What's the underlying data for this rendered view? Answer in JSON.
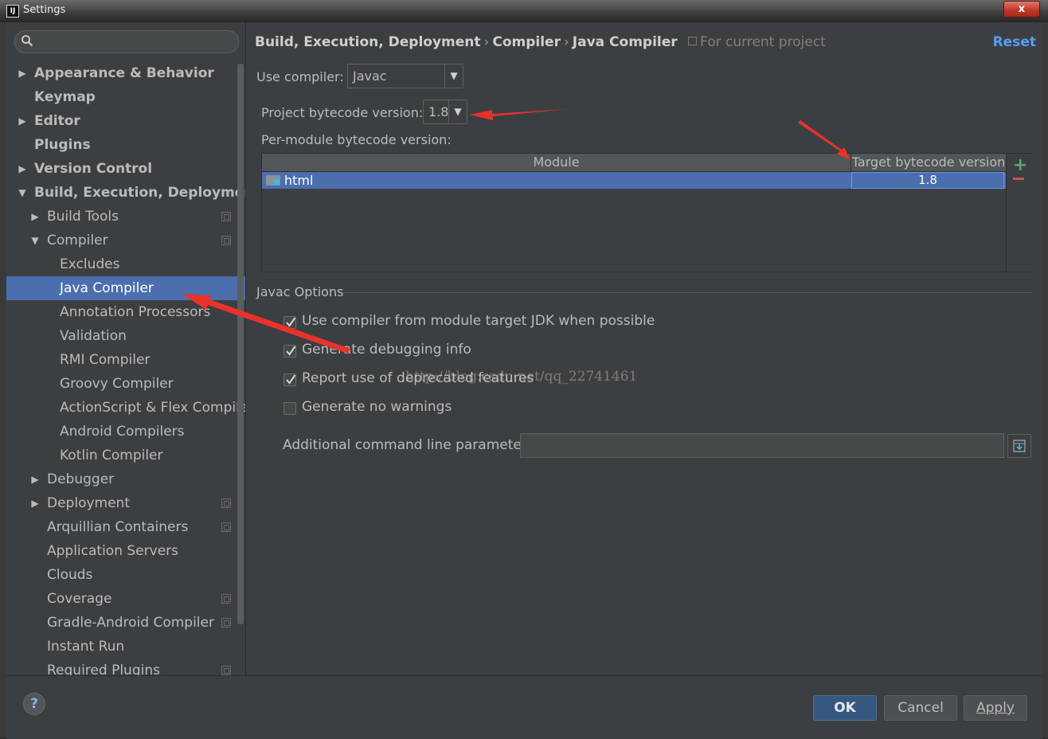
{
  "window": {
    "title": "Settings",
    "close": "x"
  },
  "sidebar": {
    "search_placeholder": "",
    "items": [
      {
        "label": "Appearance & Behavior",
        "bold": true,
        "level": 0,
        "arrow": "▶"
      },
      {
        "label": "Keymap",
        "bold": true,
        "level": 0,
        "arrow": ""
      },
      {
        "label": "Editor",
        "bold": true,
        "level": 0,
        "arrow": "▶"
      },
      {
        "label": "Plugins",
        "bold": true,
        "level": 0,
        "arrow": ""
      },
      {
        "label": "Version Control",
        "bold": true,
        "level": 0,
        "arrow": "▶"
      },
      {
        "label": "Build, Execution, Deployment",
        "bold": true,
        "level": 0,
        "arrow": "▼"
      },
      {
        "label": "Build Tools",
        "level": 1,
        "arrow": "▶",
        "project": true
      },
      {
        "label": "Compiler",
        "level": 1,
        "arrow": "▼",
        "project": true
      },
      {
        "label": "Excludes",
        "level": 2,
        "arrow": ""
      },
      {
        "label": "Java Compiler",
        "level": 2,
        "arrow": "",
        "selected": true
      },
      {
        "label": "Annotation Processors",
        "level": 2,
        "arrow": ""
      },
      {
        "label": "Validation",
        "level": 2,
        "arrow": ""
      },
      {
        "label": "RMI Compiler",
        "level": 2,
        "arrow": ""
      },
      {
        "label": "Groovy Compiler",
        "level": 2,
        "arrow": ""
      },
      {
        "label": "ActionScript & Flex Compile",
        "level": 2,
        "arrow": ""
      },
      {
        "label": "Android Compilers",
        "level": 2,
        "arrow": ""
      },
      {
        "label": "Kotlin Compiler",
        "level": 2,
        "arrow": ""
      },
      {
        "label": "Debugger",
        "level": 1,
        "arrow": "▶"
      },
      {
        "label": "Deployment",
        "level": 1,
        "arrow": "▶",
        "project": true
      },
      {
        "label": "Arquillian Containers",
        "level": 1,
        "arrow": "",
        "project": true
      },
      {
        "label": "Application Servers",
        "level": 1,
        "arrow": ""
      },
      {
        "label": "Clouds",
        "level": 1,
        "arrow": ""
      },
      {
        "label": "Coverage",
        "level": 1,
        "arrow": "",
        "project": true
      },
      {
        "label": "Gradle-Android Compiler",
        "level": 1,
        "arrow": "",
        "project": true
      },
      {
        "label": "Instant Run",
        "level": 1,
        "arrow": ""
      },
      {
        "label": "Required Plugins",
        "level": 1,
        "arrow": "",
        "project": true
      }
    ]
  },
  "breadcrumb": {
    "parts": [
      "Build, Execution, Deployment",
      "Compiler",
      "Java Compiler"
    ],
    "separator": "›",
    "scope": "For current project"
  },
  "reset_label": "Reset",
  "compiler": {
    "label": "Use compiler:",
    "value": "Javac"
  },
  "bytecode": {
    "label": "Project bytecode version:",
    "value": "1.8"
  },
  "per_module": {
    "label": "Per-module bytecode version:",
    "columns": [
      "Module",
      "Target bytecode version"
    ],
    "rows": [
      {
        "module": "html",
        "target": "1.8"
      }
    ]
  },
  "javac": {
    "section_title": "Javac Options",
    "options": [
      {
        "label": "Use compiler from module target JDK when possible",
        "checked": true
      },
      {
        "label": "Generate debugging info",
        "checked": true
      },
      {
        "label": "Report use of deprecated features",
        "checked": true
      },
      {
        "label": "Generate no warnings",
        "checked": false
      }
    ],
    "params_label": "Additional command line parameters:",
    "params_value": ""
  },
  "watermark": "http://blog.csdn.net/qq_22741461",
  "buttons": {
    "help": "?",
    "ok": "OK",
    "cancel": "Cancel",
    "apply": "Apply"
  },
  "colors": {
    "selection": "#4b6eaf",
    "link": "#589df6",
    "annotation_arrow": "#e8322b",
    "background": "#3c3f41"
  }
}
